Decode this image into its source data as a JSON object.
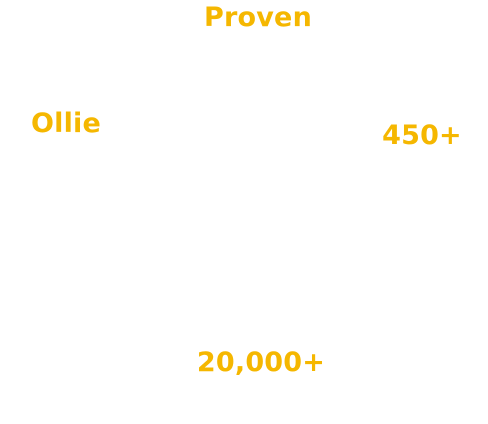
{
  "colors": {
    "background": "#ffffff",
    "accent": "#f5b700"
  },
  "stats": [
    {
      "value": "Proven",
      "caption": ""
    },
    {
      "value": "Ollie",
      "caption": ""
    },
    {
      "value": "450+",
      "caption": ""
    },
    {
      "value": "20,000+",
      "caption": ""
    }
  ]
}
